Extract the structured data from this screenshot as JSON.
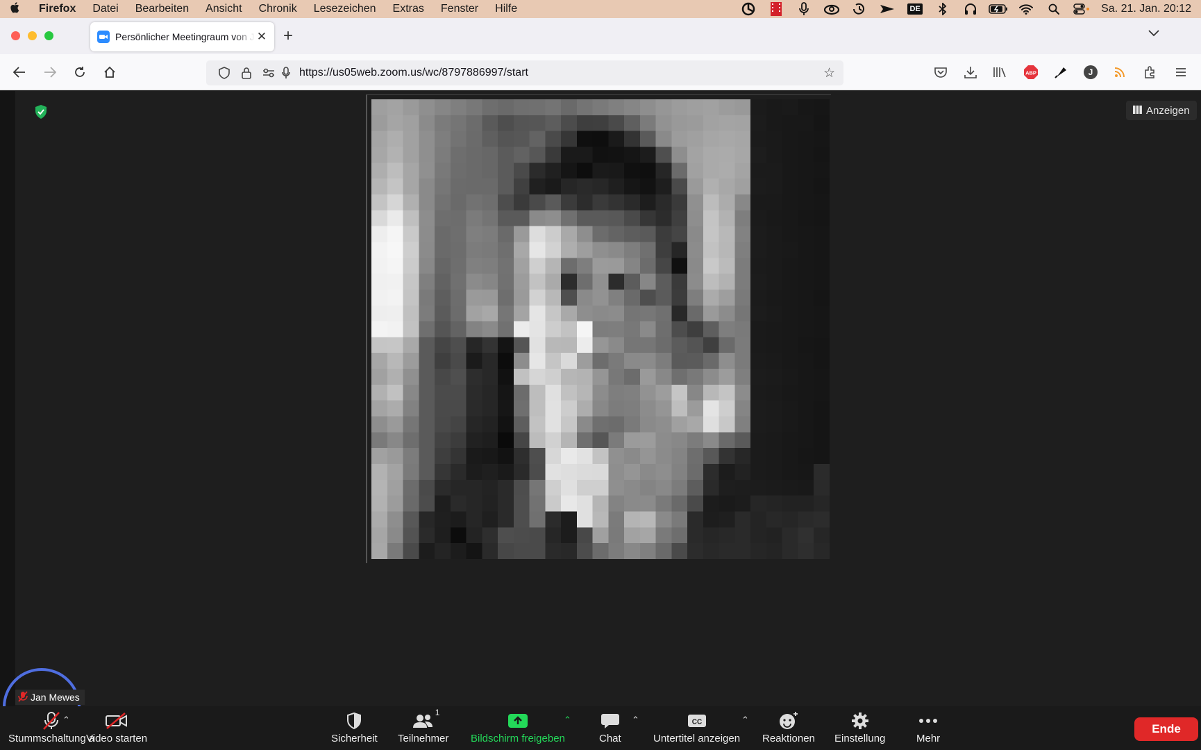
{
  "menubar": {
    "app": "Firefox",
    "items": [
      "Datei",
      "Bearbeiten",
      "Ansicht",
      "Chronik",
      "Lesezeichen",
      "Extras",
      "Fenster",
      "Hilfe"
    ],
    "input_source": "DE",
    "clock": "Sa. 21. Jan.  20:12"
  },
  "browser": {
    "tab_title": "Persönlicher Meetingraum von J",
    "url": "https://us05web.zoom.us/wc/8797886997/start",
    "abp_label": "ABP",
    "account_initial": "J"
  },
  "meeting": {
    "view_button": "Anzeigen",
    "self_view_name": "Jan Mewes",
    "video_grid": {
      "cols": 29,
      "rows": 29,
      "levels": [
        "9f9f9f a3a3a3 9a9a9a 8f8f8f 868686 7f7f7f 787878 6e6e6e 6a6a6a 6f6f6f 707070 747474 6a6a6a 747474 7a7a7a 808080 868686 8e8e8e 969696 9c9c9c 9f9f9f a1a1a1 9c9c9c 999999 1b1b1b 191919 1a1a1a 171717 161616",
        "9c9c9c a5a5a5 a0a0a0 8b8b8b 7b7b7b 757575 6c6c6c 5a5a5a 4e4e4e 555555 565656 5d5d5d 4c4c4c 3e3e3e 3f3f3f 4a4a4a 5f5f5f 7b7b7b 929292 999999 9b9b9b a2a2a2 a4a4a4 a3a3a3 1c1c1c 191919 181818 181818 151515",
        "a5a5a5 aeaeae a1a1a1 8f8f8f 7e7e7e 737373 6b6b6b 5f5f5f 555555 575757 636363 4a4a4a 363636 0f0f0f 0e0e0e 1a1a1a 333333 5a5a5a 8a8a8a 9c9c9c a0a0a0 a6a6a6 a8a8a8 a6a6a6 1b1b1b 1a1a1a 181818 171717 161616",
        "a7a7a7 b2b2b2 a1a1a1 8f8f8f 7c7c7c 6e6e6e 6a6a6a 676767 5b5b5b 626262 575757 3a3a3a 1a1a1a 1a1a1a 111111 121212 151515 1c1c1c 4f4f4f 8e8e8e a3a3a3 aaaaaa ababab a7a7a7 1d1d1d 1a1a1a 181818 171717 151515",
        "aeaeae bdbdbd a6a6a6 909090 797979 6d6d6d 6a6a6a 676767 5b5b5b 4a4a4a 2b2b2b 202020 151515 0d0d0d 1a1a1a 191919 101010 0f0f0f 262626 6b6b6b a1a1a1 aaaaaa acacac a4a4a4 1b1b1b 1b1b1b 181818 171717 161616",
        "b6b6b6 c4c4c4 a6a6a6 8a8a8a 767676 6b6b6b 6a6a6a 6a6a6a 5b5b5b 404040 202020 1a1a1a 262626 2a2a2a 272727 1f1f1f 161616 121212 1e1e1e 4a4a4a 9a9a9a b0b0b0 a8a8a8 a0a0a0 1c1c1c 1b1b1b 181818 171717 151515",
        "c4c4c4 d6d6d6 b0b0b0 8a8a8a 727272 6a6a6a 727272 6e6e6e 4d4d4d 3a3a3a 4a4a4a 5a5a5a 3b3b3b 2c2c2c 3a3a3a 333333 2a2a2a 1d1d1d 2a2a2a 3a3a3a 909090 bcbcbc acacac 888888 1a1a1a 1a1a1a 181818 171717 161616",
        "d9d9d9 eaeaea bfbfbf 8d8d8d 6e6e6e 6d6d6d 7b7b7b 747474 5a5a5a 5a5a5a 8a8a8a 8e8e8e 707070 5a5a5a 5a5a5a 585858 4a4a4a 363636 2c2c2c 3f3f3f 8e8e8e c4c4c4 b2b2b2 7e7e7e 1b1b1b 191919 181818 161616 151515",
        "eeeeee f5f5f5 c9c9c9 8c8c8c 6a6a6a 6e6e6e 7f7f7f 7c7c7c 6a6a6a 9a9a9a dddddd cccccc a9a9a9 8e8e8e 6c6c6c 646464 5d5d5d 5a5a5a 3c3c3c 454545 8a8a8a c5c5c5 b8b8b8 828282 1c1c1c 1a1a1a 181818 171717 161616",
        "f3f3f3 f7f7f7 cecece 8b8b8b 6a6a6a 6d6d6d 7c7c7c 7a7a7a 6f6f6f a8a8a8 e6e6e6 d2d2d2 aeaeae 9e9e9e 8f8f8f 8a8a8a 7e7e7e 707070 3e3e3e 262626 8c8c8c c2c2c2 b7b7b7 7f7f7f 1c1c1c 1a1a1a 191919 171717 161616",
        "f2f2f2 f5f5f5 cbcbcb 888888 666666 6e6e6e 808080 7e7e7e 727272 a1a1a1 cfcfcf b5b5b5 6d6d6d 7e7e7e 9b9b9b 9a9a9a 858585 6c6c6c 464646 101010 8a8a8a c9c9c9 bbbbbb 7c7c7c 1b1b1b 1a1a1a 181818 171717 161616",
        "f0f0f0 f1f1f1 c6c6c6 7f7f7f 626262 707070 8b8b8b 868686 717171 9c9c9c c2c2c2 aaaaaa 2c2c2c 6e6e6e 909090 2c2c2c 5c5c5c 878787 5c5c5c 3a3a3a 8c8c8c bdbdbd b2b2b2 7c7c7c 1c1c1c 1a1a1a 181818 171717 161616",
        "f1f1f1 f3f3f3 c4c4c4 7a7a7a 5e5e5e 6d6d6d 9a9a9a 999999 6e6e6e 9a9a9a d2d2d2 b8b8b8 4e4e4e 8a8a8a 929292 808080 6a6a6a 4e4e4e 5b5b5b 3c3c3c 7e7e7e ababab 9e9e9e 7a7a7a 1b1b1b 191919 181818 171717 151515",
        "eeeeee efefef c0c0c0 7c7c7c 5b5b5b 6c6c6c a2a2a2 a8a8a8 767676 a4a4a4 e5e5e5 c6c6c6 a9a9a9 8e8e8e 8a8a8a 8c8c8c 757575 777777 707070 282828 6a6a6a 9a9a9a 8c8c8c 767676 1c1c1c 1a1a1a 181818 171717 161616",
        "f4f4f4 f2f2f2 c2c2c2 6f6f6f 555555 636363 838383 8a8a8a 717171 ececec e4e4e4 cdcdcd c2c2c2 f5f5f5 7d7d7d 7e7e7e 787878 8a8a8a 6e6e6e 4d4d4d 3e3e3e 5e5e5e 7e7e7e 7a7a7a 1a1a1a 191919 181818 171717 161616",
        "c5c5c5 c6c6c6 a9a9a9 5a5a5a 454545 4e4e4e 262626 333333 141414 555555 e1e1e1 b8b8b8 b7b7b7 ececec 969696 8a8a8a 767676 767676 6c6c6c 5c5c5c 545454 3f3f3f 6a6a6a 7b7b7b 1a1a1a 191919 181818 161616 151515",
        "a7a7a7 b8b8b8 9c9c9c 5a5a5a 3f3f3f 4a4a4a 1b1b1b 282828 0c0c0c 8d8d8d e6e6e6 c5c5c5 dadada 9d9d9d 6d6d6d 7a7a7a 8a8a8a 8b8b8b 7d7d7d 5a5a5a 5b5b5b 6a6a6a 8e8e8e 7b7b7b 1b1b1b 1a1a1a 181818 171717 151515",
        "a1a1a1 b0b0b0 909090 5a5a5a 484848 4f4f4f 2d2d2d 282828 111111 c1c1c1 d6d6d6 cfcfcf b6b6b6 b3b3b3 959595 787878 6c6c6c 9a9a9a 888888 6f6f6f 797979 8c8c8c 9c9c9c 7f7f7f 1c1c1c 1b1b1b 191919 171717 161616",
        "b1b1b1 c1c1c1 888888 5a5a5a 4b4b4b 4b4b4b 2b2b2b 262626 151515 6c6c6c bdbdbd e0e0e0 c1c1c1 b6b6b6 8c8c8c 7e7e7e 808080 929292 9d9d9d c5c5c5 878787 b8b8b8 c4c4c4 8c8c8c 1b1b1b 1a1a1a 181818 171717 161616",
        "a4a4a4 acacac 828282 5a5a5a 4a4a4a 4a4a4a 2a2a2a 262626 161616 6f6f6f bebebe e1e1e1 cdcdcd adadad 888888 7c7c7c 7e7e7e 8c8c8c 959595 bebebe 9b9b9b e4e4e4 cecece 858585 1c1c1c 1b1b1b 191919 171717 151515",
        "8e8e8e 9a9a9a 767676 5a5a5a 494949 444444 262626 222222 121212 5e5e5e c2c2c2 e1e1e1 c7c7c7 8a8a8a 6f6f6f 6c6c6c 7a7a7a 8a8a8a 8e8e8e a0a0a0 a8a8a8 dfdfdf c8c8c8 808080 1c1c1c 1b1b1b 191919 171717 151515",
        "7a7a7a 888888 6e6e6e 5a5a5a 434343 3c3c3c 212121 1e1e1e 0a0a0a 464646 bcbcbc d1d1d1 b5b5b5 6f6f6f 565656 7b7b7b 9b9b9b 9c9c9c 8c8c8c 888888 7c7c7c 8a8a8a 6a6a6a 5a5a5a 1b1b1b 1a1a1a 181818 171717 151515",
        "a1a1a1 9a9a9a 7c7c7c 5a5a5a 3e3e3e 343434 1a1a1a 181818 121212 2e2e2e 4e4e4e d7d7d7 e9e9e9 e2e2e2 c3c3c3 909090 8a8a8a 959595 8b8b8b 848484 6e6e6e 585858 333333 272727 1b1b1b 1a1a1a 181818 161616 151515",
        "b2b2b2 a3a3a3 7a7a7a 5a5a5a 363636 2a2a2a 1c1c1c 1f1f1f 1a1a1a 2a2a2a 4c4c4c e1e1e1 dedede dbdbdb dadada 8e8e8e 959595 8a8a8a 8e8e8e 828282 6c6c6c 2c2c2c 1c1c1c 222222 1b1b1b 1a1a1a 181818 171717 2b2b2b",
        "b4b4b4 a0a0a0 6c6c6c 4a4a4a 2b2b2b 262626 262626 232323 2a2a2a 4d4d4d 767676 cfcfcf e0e0e0 cfcfcf cfcfcf 8f8f8f 8a8a8a 848484 898989 7c7c7c 5d5d5d 2a2a2a 1e1e1e 1d1d1d 1c1c1c 1b1b1b 1a1a1a 191919 2a2a2a",
        "b2b2b2 9c9c9c 6a6a6a 4c4c4c 1e1e1e 2a2a2a 262626 222222 2a2a2a 4e4e4e 727272 cacaca e8e8e8 e0e0e0 b5b5b5 838383 8a8a8a 8b8b8b 7a7a7a 6a6a6a 4a4a4a 1c1c1c 1a1a1a 1c1c1c 262626 242424 222222 222222 262626",
        "ababab 8e8e8e 585858 272727 1f1f1f 1c1c1c 262626 1f1f1f 2a2a2a 4e4e4e 707070 2b2b2b 1c1c1c e0e0e0 b8b8b8 7b7b7b b4b4b4 b8b8b8 8a8a8a 7a7a7a 2a2a2a 1d1d1d 1f1f1f 2a2a2a 242424 282828 262626 2a2a2a 2c2c2c",
        "a6a6a6 8a8a8a 535353 2a2a2a 1e1e1e 0c0c0c 232323 2e2e2e 4e4e4e 4c4c4c 4a4a4a 262626 1c1c1c 484848 a0a0a0 7a7a7a a2a2a2 a6a6a6 7a7a7a 6e6e6e 2a2a2a 262626 282828 2a2a2a 242424 222222 2a2a2a 303030 262626",
        "a8a8a8 7a7a7a 4a4a4a 1c1c1c 242424 1c1c1c 141414 2a2a2a 474747 4a4a4a 4a4a4a 2a2a2a 282828 4c4c4c 6c6c6c 7c7c7c 888888 808080 6a6a6a 4a4a4a 2c2c2c 282828 2a2a2a 2a2a2a 262626 242424 2a2a2a 2e2e2e 282828"
      ]
    }
  },
  "toolbar": {
    "mute_label": "Stummschaltung a",
    "video_label": "Video starten",
    "buttons": [
      {
        "label": "Sicherheit",
        "icon": "shield-icon"
      },
      {
        "label": "Teilnehmer",
        "icon": "participants-icon",
        "count": "1"
      },
      {
        "label": "Bildschirm freigeben",
        "icon": "share-screen-icon"
      },
      {
        "label": "Chat",
        "icon": "chat-icon"
      },
      {
        "label": "Untertitel anzeigen",
        "icon": "cc-icon"
      },
      {
        "label": "Reaktionen",
        "icon": "reactions-icon"
      },
      {
        "label": "Einstellung",
        "icon": "gear-icon"
      },
      {
        "label": "Mehr",
        "icon": "more-icon"
      }
    ],
    "end_label": "Ende",
    "share_color": "#23d959",
    "end_color": "#e02828"
  }
}
